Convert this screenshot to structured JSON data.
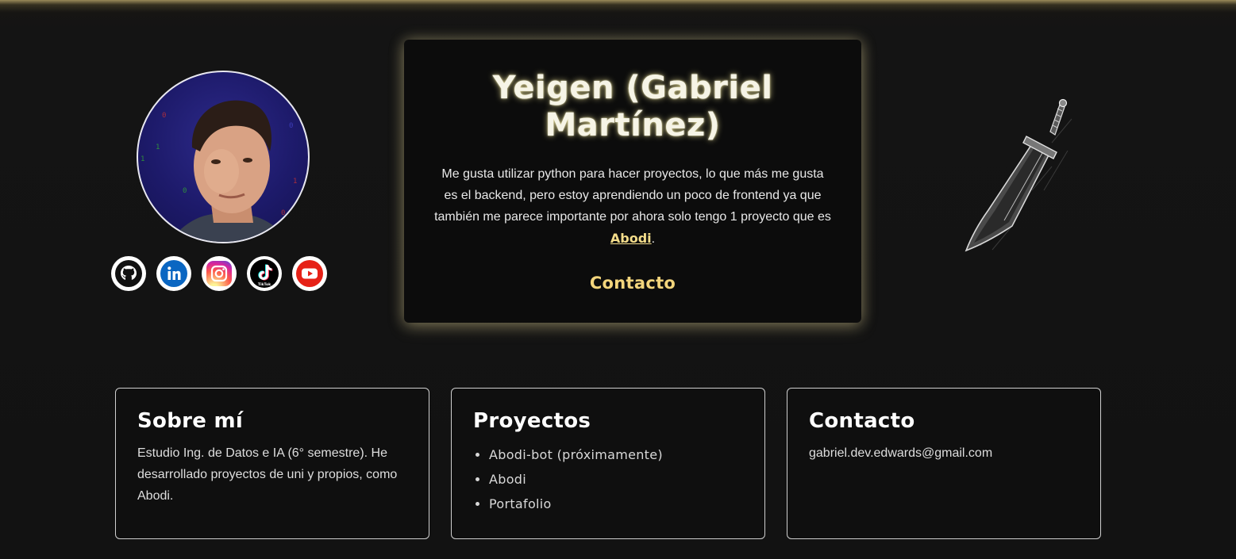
{
  "profile": {
    "avatar_alt": "Foto de perfil",
    "socials": [
      {
        "name": "github-icon",
        "color": "#111111"
      },
      {
        "name": "linkedin-icon",
        "color": "#0a66c2"
      },
      {
        "name": "instagram-icon",
        "color": "#d6249f"
      },
      {
        "name": "tiktok-icon",
        "color": "#000000",
        "text": "TikTok"
      },
      {
        "name": "youtube-icon",
        "color": "#e62117"
      }
    ]
  },
  "hero": {
    "title_line1": "Yeigen (Gabriel",
    "title_line2": "Martínez)",
    "description_before": "Me gusta utilizar python para hacer proyectos, lo que más me gusta es el backend, pero estoy aprendiendo un poco de frontend ya que también me parece importante por ahora solo tengo 1 proyecto que es ",
    "description_link": "Abodi",
    "description_after": ".",
    "contact_label": "Contacto"
  },
  "cards": {
    "about": {
      "title": "Sobre mí",
      "text": "Estudio Ing. de Datos e IA (6° semestre). He desarrollado proyectos de uni y propios, como Abodi."
    },
    "projects": {
      "title": "Proyectos",
      "items": [
        "Abodi-bot (próximamente)",
        "Abodi",
        "Portafolio"
      ]
    },
    "contact": {
      "title": "Contacto",
      "email": "gabriel.dev.edwards@gmail.com"
    }
  },
  "colors": {
    "accent": "#f3d57c",
    "background": "#121212",
    "card_border": "#cfcfcf"
  }
}
